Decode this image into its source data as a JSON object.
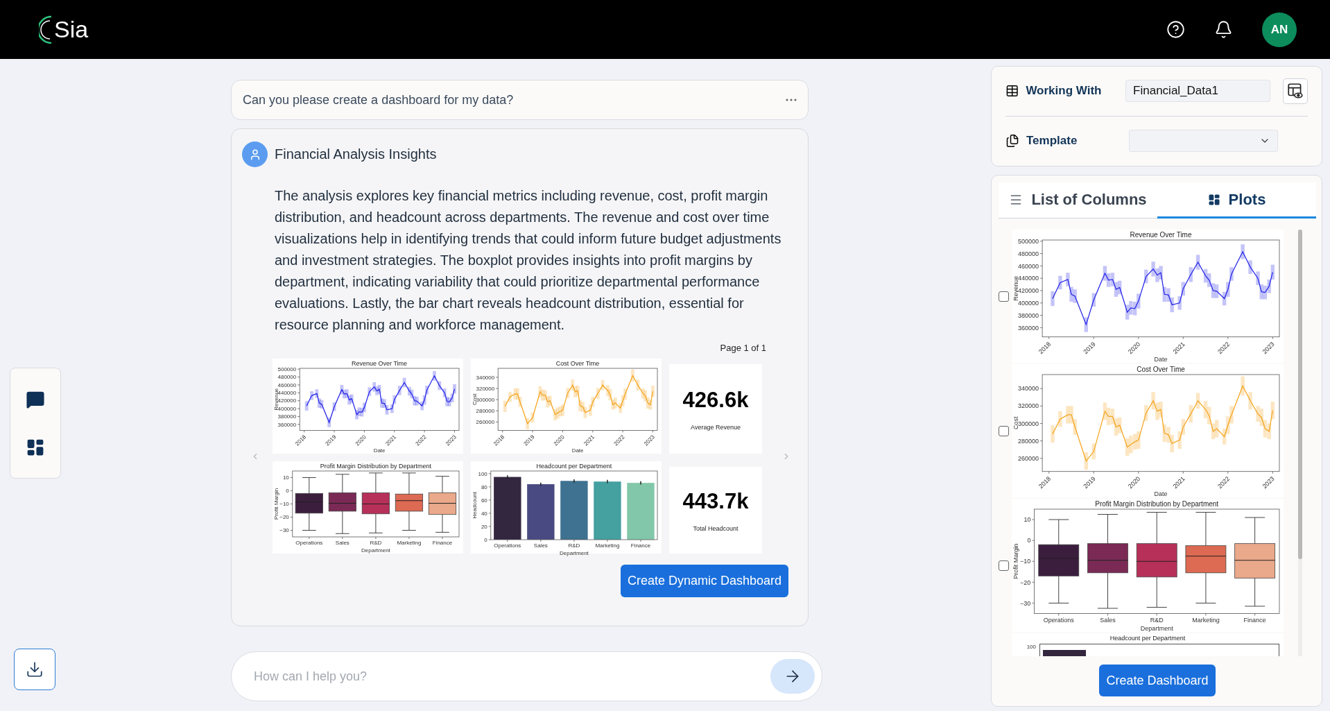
{
  "header": {
    "logo": "Sia",
    "avatar": "AN"
  },
  "query": {
    "text": "Can you please create a dashboard for my data?"
  },
  "response": {
    "title": "Financial Analysis Insights",
    "body": "The analysis explores key financial metrics including revenue, cost, profit margin distribution, and headcount across departments. The revenue and cost over time visualizations help in identifying trends that could inform future budget adjustments and investment strategies. The boxplot provides insights into profit margins by department, indicating variability that could prioritize departmental performance evaluations. Lastly, the bar chart reveals headcount distribution, essential for resource planning and workforce management.",
    "page": "Page 1 of 1",
    "button": "Create Dynamic Dashboard",
    "tiles": [
      {
        "kind": "chart",
        "chart_data": {
          "type": "line",
          "title": "Revenue Over Time",
          "xlabel": "Date",
          "ylabel": "Revenue",
          "xlim": [
            2017.85,
            2023.15
          ],
          "ylim": [
            345000,
            502000
          ],
          "xticks": [
            2018,
            2019,
            2020,
            2021,
            2022,
            2023
          ],
          "yticks": [
            360000,
            380000,
            400000,
            420000,
            440000,
            460000,
            480000,
            500000
          ],
          "x": [
            2018.08,
            2018.25,
            2018.42,
            2018.5,
            2018.58,
            2018.83,
            2019.0,
            2019.25,
            2019.33,
            2019.42,
            2019.5,
            2019.58,
            2019.75,
            2019.83,
            2019.92,
            2020.0,
            2020.17,
            2020.33,
            2020.42,
            2020.5,
            2020.58,
            2020.67,
            2020.75,
            2020.92,
            2021.0,
            2021.17,
            2021.33,
            2021.5,
            2021.58,
            2021.67,
            2021.75,
            2021.92,
            2022.0,
            2022.08,
            2022.33,
            2022.5,
            2022.67,
            2022.75,
            2022.83,
            2022.92,
            2023.0
          ],
          "series": [
            {
              "color": "#2a2ae8",
              "values": [
                407000,
                433000,
                438000,
                414000,
                411000,
                365000,
                405000,
                448000,
                437000,
                438000,
                422000,
                425000,
                385000,
                392000,
                391000,
                403000,
                443000,
                455000,
                445000,
                449000,
                414000,
                413000,
                397000,
                400000,
                423000,
                446000,
                466000,
                444000,
                437000,
                420000,
                419000,
                407000,
                422000,
                447000,
                483000,
                458000,
                440000,
                418000,
                417000,
                427000,
                450000
              ],
              "errors": [
                12000,
                11000,
                11000,
                12000,
                11000,
                12000,
                11000,
                12000,
                11000,
                11000,
                12000,
                11000,
                12000,
                11000,
                11000,
                12000,
                11000,
                12000,
                11000,
                11000,
                12000,
                11000,
                12000,
                11000,
                11000,
                12000,
                12000,
                11000,
                11000,
                12000,
                11000,
                11000,
                12000,
                11000,
                12000,
                11000,
                11000,
                12000,
                11000,
                11000,
                12000
              ]
            }
          ]
        }
      },
      {
        "kind": "chart",
        "chart_data": {
          "type": "line",
          "title": "Cost Over Time",
          "xlabel": "Date",
          "ylabel": "Cost",
          "xlim": [
            2017.85,
            2023.15
          ],
          "ylim": [
            245000,
            356000
          ],
          "xticks": [
            2018,
            2019,
            2020,
            2021,
            2022,
            2023
          ],
          "yticks": [
            260000,
            280000,
            300000,
            320000,
            340000
          ],
          "x": [
            2018.08,
            2018.25,
            2018.42,
            2018.5,
            2018.58,
            2018.83,
            2019.0,
            2019.25,
            2019.33,
            2019.42,
            2019.5,
            2019.58,
            2019.75,
            2019.83,
            2019.92,
            2020.0,
            2020.17,
            2020.33,
            2020.42,
            2020.5,
            2020.58,
            2020.67,
            2020.75,
            2020.92,
            2021.0,
            2021.17,
            2021.33,
            2021.5,
            2021.58,
            2021.67,
            2021.75,
            2021.92,
            2022.0,
            2022.08,
            2022.33,
            2022.5,
            2022.67,
            2022.75,
            2022.83,
            2022.92,
            2023.0
          ],
          "series": [
            {
              "color": "#f5a623",
              "values": [
                288000,
                305000,
                310000,
                310000,
                296000,
                257000,
                268000,
                314000,
                308000,
                308000,
                296000,
                298000,
                273000,
                276000,
                279000,
                281000,
                312000,
                326000,
                314000,
                316000,
                289000,
                287000,
                277000,
                281000,
                296000,
                311000,
                326000,
                316000,
                309000,
                291000,
                294000,
                285000,
                298000,
                310000,
                343000,
                326000,
                311000,
                307000,
                294000,
                291000,
                315000
              ],
              "errors": [
                10000,
                9000,
                10000,
                10000,
                9000,
                10000,
                9000,
                10000,
                10000,
                9000,
                10000,
                9000,
                10000,
                10000,
                9000,
                10000,
                9000,
                10000,
                10000,
                9000,
                10000,
                9000,
                10000,
                10000,
                9000,
                10000,
                9000,
                10000,
                10000,
                9000,
                10000,
                9000,
                10000,
                10000,
                11000,
                10000,
                9000,
                10000,
                10000,
                9000,
                10000
              ]
            }
          ]
        }
      },
      {
        "kind": "kpi",
        "value": "426.6k",
        "label": "Average Revenue"
      },
      {
        "kind": "boxplot",
        "title": "Profit Margin Distribution by Department",
        "xlabel": "Department",
        "ylabel": "Profit Margin",
        "yticks": [
          "10",
          "0",
          "−10",
          "−20",
          "−30"
        ],
        "boxes": [
          {
            "label": "Operations",
            "color": "#3b1e3e"
          },
          {
            "label": "Sales",
            "color": "#7a2a55"
          },
          {
            "label": "R&D",
            "color": "#b7305a"
          },
          {
            "label": "Marketing",
            "color": "#dd6a52"
          },
          {
            "label": "Finance",
            "color": "#eaa98a"
          }
        ]
      },
      {
        "kind": "chart",
        "chart_data": {
          "type": "bar",
          "title": "Headcount per Department",
          "xlabel": "Department",
          "ylabel": "Headcount",
          "ylim": [
            0,
            104
          ],
          "yticks": [
            0,
            20,
            40,
            60,
            80,
            100
          ],
          "categories": [
            "Operations",
            "Sales",
            "R&D",
            "Marketing",
            "Finance"
          ],
          "colors": [
            "#33263f",
            "#4a4a82",
            "#3f7191",
            "#45a0a0",
            "#82c7a9"
          ],
          "values": [
            95,
            84,
            89,
            88,
            86
          ],
          "errors": [
            2.5,
            2.5,
            2.5,
            2.5,
            2.5
          ]
        }
      },
      {
        "kind": "kpi",
        "value": "443.7k",
        "label": "Total Headcount"
      }
    ]
  },
  "composer": {
    "placeholder": "How can I help you?"
  },
  "context": {
    "working_label": "Working With",
    "working_value": "Financial_Data1",
    "template_label": "Template"
  },
  "tabs": [
    {
      "label": "List of Columns",
      "selected": false
    },
    {
      "label": "Plots",
      "selected": true
    }
  ],
  "plots": [
    {
      "kind": "chart",
      "checked": false,
      "chart_data": {
        "type": "line",
        "title": "Revenue Over Time",
        "xlabel": "Date",
        "ylabel": "Revenue",
        "xlim": [
          2017.85,
          2023.15
        ],
        "ylim": [
          345000,
          502000
        ],
        "xticks": [
          2018,
          2019,
          2020,
          2021,
          2022,
          2023
        ],
        "yticks": [
          360000,
          380000,
          400000,
          420000,
          440000,
          460000,
          480000,
          500000
        ],
        "x": [
          2018.08,
          2018.25,
          2018.42,
          2018.5,
          2018.58,
          2018.83,
          2019.0,
          2019.25,
          2019.33,
          2019.42,
          2019.5,
          2019.58,
          2019.75,
          2019.83,
          2019.92,
          2020.0,
          2020.17,
          2020.33,
          2020.42,
          2020.5,
          2020.58,
          2020.67,
          2020.75,
          2020.92,
          2021.0,
          2021.17,
          2021.33,
          2021.5,
          2021.58,
          2021.67,
          2021.75,
          2021.92,
          2022.0,
          2022.08,
          2022.33,
          2022.5,
          2022.67,
          2022.75,
          2022.83,
          2022.92,
          2023.0
        ],
        "series": [
          {
            "color": "#2a2ae8",
            "values": [
              407000,
              433000,
              438000,
              414000,
              411000,
              365000,
              405000,
              448000,
              437000,
              438000,
              422000,
              425000,
              385000,
              392000,
              391000,
              403000,
              443000,
              455000,
              445000,
              449000,
              414000,
              413000,
              397000,
              400000,
              423000,
              446000,
              466000,
              444000,
              437000,
              420000,
              419000,
              407000,
              422000,
              447000,
              483000,
              458000,
              440000,
              418000,
              417000,
              427000,
              450000
            ],
            "errors": [
              12000,
              11000,
              11000,
              12000,
              11000,
              12000,
              11000,
              12000,
              11000,
              11000,
              12000,
              11000,
              12000,
              11000,
              11000,
              12000,
              11000,
              12000,
              11000,
              11000,
              12000,
              11000,
              12000,
              11000,
              11000,
              12000,
              12000,
              11000,
              11000,
              12000,
              11000,
              11000,
              12000,
              11000,
              12000,
              11000,
              11000,
              12000,
              11000,
              11000,
              12000
            ]
          }
        ]
      }
    },
    {
      "kind": "chart",
      "checked": false,
      "chart_data": {
        "type": "line",
        "title": "Cost Over Time",
        "xlabel": "Date",
        "ylabel": "Cost",
        "xlim": [
          2017.85,
          2023.15
        ],
        "ylim": [
          245000,
          356000
        ],
        "xticks": [
          2018,
          2019,
          2020,
          2021,
          2022,
          2023
        ],
        "yticks": [
          260000,
          280000,
          300000,
          320000,
          340000
        ],
        "x": [
          2018.08,
          2018.25,
          2018.42,
          2018.5,
          2018.58,
          2018.83,
          2019.0,
          2019.25,
          2019.33,
          2019.42,
          2019.5,
          2019.58,
          2019.75,
          2019.83,
          2019.92,
          2020.0,
          2020.17,
          2020.33,
          2020.42,
          2020.5,
          2020.58,
          2020.67,
          2020.75,
          2020.92,
          2021.0,
          2021.17,
          2021.33,
          2021.5,
          2021.58,
          2021.67,
          2021.75,
          2021.92,
          2022.0,
          2022.08,
          2022.33,
          2022.5,
          2022.67,
          2022.75,
          2022.83,
          2022.92,
          2023.0
        ],
        "series": [
          {
            "color": "#f5a623",
            "values": [
              288000,
              305000,
              310000,
              310000,
              296000,
              257000,
              268000,
              314000,
              308000,
              308000,
              296000,
              298000,
              273000,
              276000,
              279000,
              281000,
              312000,
              326000,
              314000,
              316000,
              289000,
              287000,
              277000,
              281000,
              296000,
              311000,
              326000,
              316000,
              309000,
              291000,
              294000,
              285000,
              298000,
              310000,
              343000,
              326000,
              311000,
              307000,
              294000,
              291000,
              315000
            ],
            "errors": [
              10000,
              9000,
              10000,
              10000,
              9000,
              10000,
              9000,
              10000,
              10000,
              9000,
              10000,
              9000,
              10000,
              10000,
              9000,
              10000,
              9000,
              10000,
              10000,
              9000,
              10000,
              9000,
              10000,
              10000,
              9000,
              10000,
              9000,
              10000,
              10000,
              9000,
              10000,
              9000,
              10000,
              10000,
              11000,
              10000,
              9000,
              10000,
              10000,
              9000,
              10000
            ]
          }
        ]
      }
    },
    {
      "kind": "boxplot",
      "checked": false,
      "title": "Profit Margin Distribution by Department",
      "xlabel": "Department",
      "ylabel": "Profit Margin",
      "yticks": [
        "10",
        "0",
        "−10",
        "−20",
        "−30"
      ],
      "boxes": [
        {
          "label": "Operations",
          "color": "#3b1e3e"
        },
        {
          "label": "Sales",
          "color": "#7a2a55"
        },
        {
          "label": "R&D",
          "color": "#b7305a"
        },
        {
          "label": "Marketing",
          "color": "#dd6a52"
        },
        {
          "label": "Finance",
          "color": "#eaa98a"
        }
      ]
    },
    {
      "kind": "partial",
      "title": "Headcount per Department",
      "tick": "100"
    }
  ],
  "create_button": "Create Dashboard"
}
